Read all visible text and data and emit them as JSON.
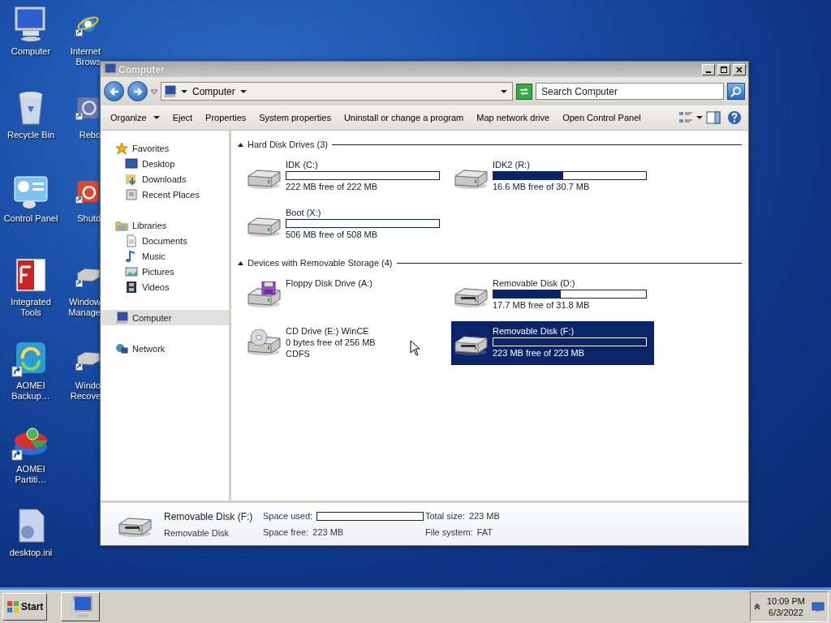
{
  "desktop": {
    "icon_columns": [
      {
        "icons": [
          {
            "label": "Computer",
            "kind": "computer",
            "shortcut": false
          },
          {
            "label": "Recycle Bin",
            "kind": "recycle",
            "shortcut": false
          },
          {
            "label": "Control Panel",
            "kind": "control-panel",
            "shortcut": false
          },
          {
            "label": "Integrated Tools",
            "kind": "tools",
            "shortcut": false
          },
          {
            "label": "AOMEI Backup…",
            "kind": "backup",
            "shortcut": true
          },
          {
            "label": "AOMEI Partiti…",
            "kind": "partition",
            "shortcut": true
          },
          {
            "label": "desktop.ini",
            "kind": "settings-file",
            "shortcut": false
          }
        ]
      },
      {
        "icons": [
          {
            "label": "Internet Brows",
            "kind": "browser",
            "shortcut": true
          },
          {
            "label": "Rebo",
            "kind": "reboot",
            "shortcut": true
          },
          {
            "label": "Shutd",
            "kind": "shutdown",
            "shortcut": true
          },
          {
            "label": "Window Manage",
            "kind": "drive",
            "shortcut": true
          },
          {
            "label": "Windo Recove",
            "kind": "drive",
            "shortcut": true
          }
        ]
      }
    ]
  },
  "window": {
    "title": "Computer",
    "address": {
      "path": "Computer"
    },
    "search": {
      "placeholder": "Search Computer"
    },
    "toolbar": [
      {
        "label": "Organize",
        "dropdown": true
      },
      {
        "label": "Eject",
        "dropdown": false
      },
      {
        "label": "Properties",
        "dropdown": false
      },
      {
        "label": "System properties",
        "dropdown": false
      },
      {
        "label": "Uninstall or change a program",
        "dropdown": false
      },
      {
        "label": "Map network drive",
        "dropdown": false
      },
      {
        "label": "Open Control Panel",
        "dropdown": false
      }
    ],
    "navigation": [
      {
        "label": "Favorites",
        "kind": "star",
        "selected": false,
        "children": [
          {
            "label": "Desktop",
            "kind": "desktop",
            "selected": false
          },
          {
            "label": "Downloads",
            "kind": "downloads",
            "selected": false
          },
          {
            "label": "Recent Places",
            "kind": "recent",
            "selected": false
          }
        ]
      },
      {
        "label": "Libraries",
        "kind": "libraries",
        "selected": false,
        "children": [
          {
            "label": "Documents",
            "kind": "document",
            "selected": false
          },
          {
            "label": "Music",
            "kind": "music",
            "selected": false
          },
          {
            "label": "Pictures",
            "kind": "pictures",
            "selected": false
          },
          {
            "label": "Videos",
            "kind": "videos",
            "selected": false
          }
        ]
      },
      {
        "label": "Computer",
        "kind": "computer",
        "selected": true
      },
      {
        "label": "Network",
        "kind": "network",
        "selected": false
      }
    ],
    "groups": [
      {
        "title": "Hard Disk Drives (3)",
        "expanded": true,
        "items": [
          {
            "name": "IDK (C:)",
            "kind": "hard",
            "level": 0,
            "lines": [
              "222 MB free of 222 MB"
            ],
            "selected": false
          },
          {
            "name": "IDK2 (R:)",
            "kind": "hard",
            "level": 0.46,
            "lines": [
              "16.6 MB free of 30.7 MB"
            ],
            "selected": false
          },
          {
            "name": "Boot (X:)",
            "kind": "hard",
            "level": 0,
            "lines": [
              "506 MB free of 508 MB"
            ],
            "selected": false
          }
        ]
      },
      {
        "title": "Devices with Removable Storage (4)",
        "expanded": true,
        "items": [
          {
            "name": "Floppy Disk Drive (A:)",
            "kind": "floppy",
            "selected": false
          },
          {
            "name": "Removable Disk (D:)",
            "kind": "removable",
            "level": 0.44,
            "lines": [
              "17.7 MB free of 31.8 MB"
            ],
            "selected": false
          },
          {
            "name": "CD Drive (E:) WinCE",
            "kind": "cd",
            "lines": [
              "0 bytes free of 256 MB",
              "CDFS"
            ],
            "selected": false
          },
          {
            "name": "Removable Disk (F:)",
            "kind": "removable",
            "level": 0,
            "lines": [
              "223 MB free of 223 MB"
            ],
            "selected": true
          }
        ]
      }
    ],
    "details": {
      "name": "Removable Disk (F:)",
      "type": "Removable Disk",
      "fields": [
        {
          "label": "Space used:",
          "kind": "bar",
          "level": 0
        },
        {
          "label": "Space free:",
          "kind": "text",
          "value": "223 MB"
        },
        {
          "label": "Total size:",
          "kind": "text",
          "value": "223 MB"
        },
        {
          "label": "File system:",
          "kind": "text",
          "value": "FAT"
        }
      ]
    }
  },
  "taskbar": {
    "start": "Start",
    "time": "10:09 PM",
    "date": "6/3/2022"
  }
}
